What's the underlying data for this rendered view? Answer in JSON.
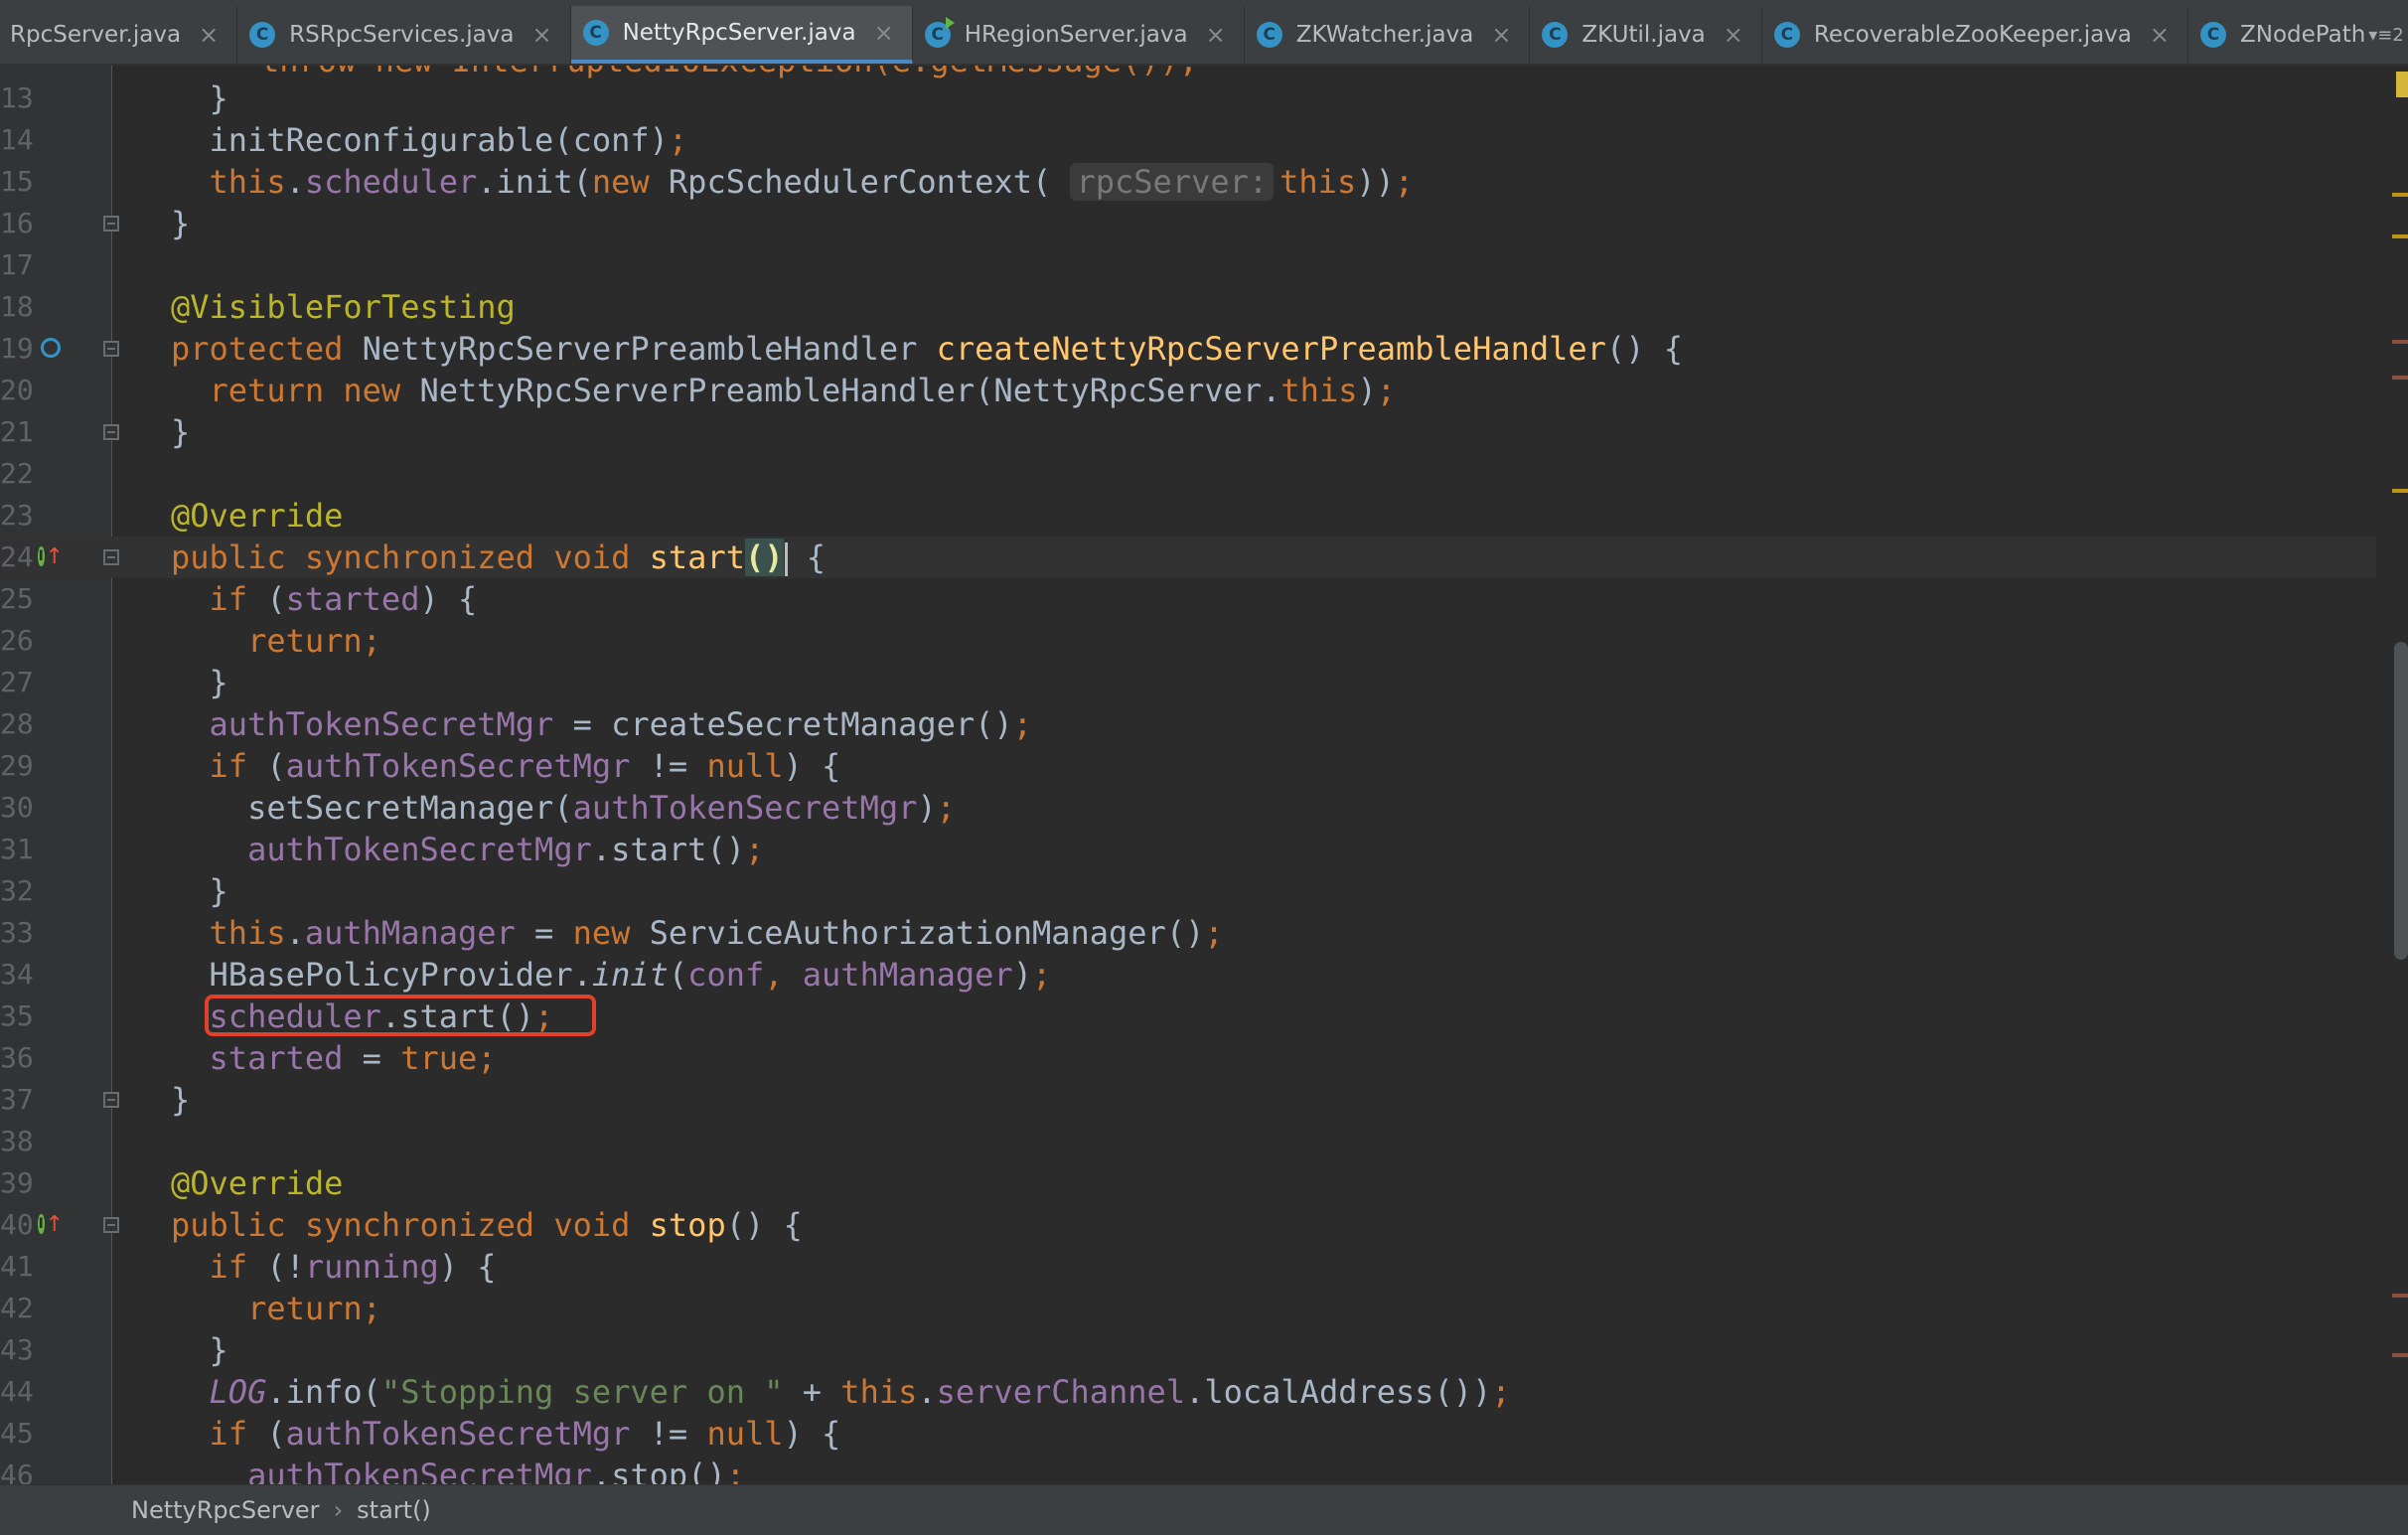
{
  "tabs": [
    {
      "label": "RpcServer.java",
      "active": false,
      "icon": "class-icon"
    },
    {
      "label": "RSRpcServices.java",
      "active": false,
      "icon": "class-icon"
    },
    {
      "label": "NettyRpcServer.java",
      "active": true,
      "icon": "class-icon"
    },
    {
      "label": "HRegionServer.java",
      "active": false,
      "icon": "runnable-class-icon"
    },
    {
      "label": "ZKWatcher.java",
      "active": false,
      "icon": "class-icon"
    },
    {
      "label": "ZKUtil.java",
      "active": false,
      "icon": "class-icon"
    },
    {
      "label": "RecoverableZooKeeper.java",
      "active": false,
      "icon": "class-icon"
    },
    {
      "label": "ZNodePaths.java",
      "active": false,
      "icon": "class-icon"
    }
  ],
  "tab_icon_letter": "C",
  "tab_close_glyph": "×",
  "tab_menu_label": "▾≡2",
  "editor": {
    "clipped_top_text": "throw new InterruptedIOException(e.getMessage());",
    "line_numbers": [
      "13",
      "14",
      "15",
      "16",
      "17",
      "18",
      "19",
      "20",
      "21",
      "22",
      "23",
      "24",
      "25",
      "26",
      "27",
      "28",
      "29",
      "30",
      "31",
      "32",
      "33",
      "34",
      "35",
      "36",
      "37",
      "38",
      "39",
      "40",
      "41",
      "42",
      "43",
      "44",
      "45",
      "46"
    ],
    "hint_rpcServer": "rpcServer:",
    "strings": {
      "stopping": "\"Stopping server on \""
    }
  },
  "breadcrumb": {
    "class": "NettyRpcServer",
    "method": "start()",
    "separator": "›"
  },
  "colors": {
    "keyword": "#cc7832",
    "field": "#9876aa",
    "method": "#ffc66d",
    "annotation": "#bbb529",
    "string": "#6a8759",
    "highlight_box": "#e0412a"
  }
}
